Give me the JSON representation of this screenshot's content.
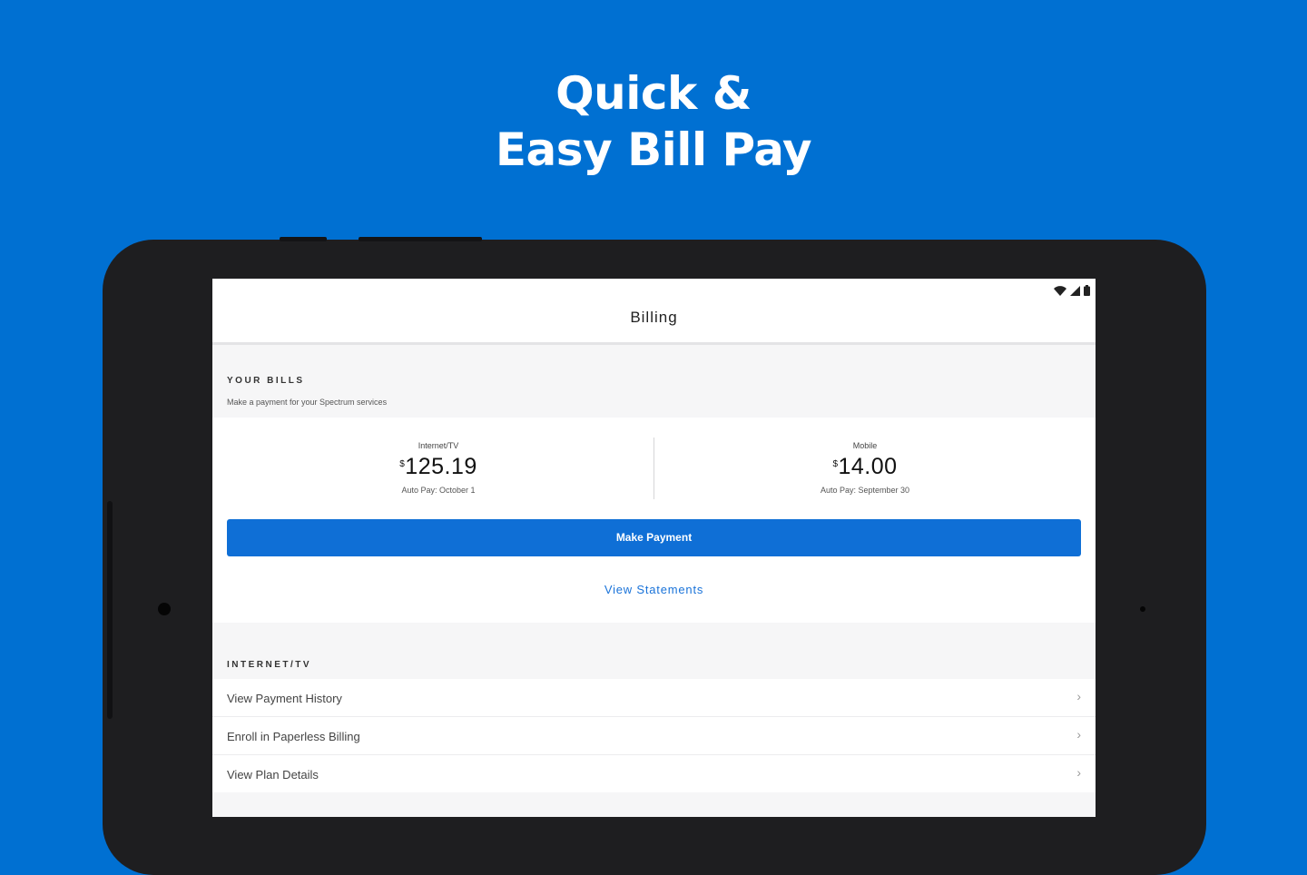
{
  "hero": {
    "line1": "Quick &",
    "line2": "Easy Bill Pay"
  },
  "appbar": {
    "title": "Billing"
  },
  "bills_section": {
    "label": "YOUR BILLS",
    "subtitle": "Make a payment for your Spectrum services",
    "bills": [
      {
        "label": "Internet/TV",
        "currency": "$",
        "amount": "125.19",
        "autopay": "Auto Pay: October 1"
      },
      {
        "label": "Mobile",
        "currency": "$",
        "amount": "14.00",
        "autopay": "Auto Pay: September 30"
      }
    ],
    "make_payment_label": "Make Payment",
    "view_statements_label": "View Statements"
  },
  "internet_section": {
    "label": "INTERNET/TV",
    "items": [
      {
        "label": "View Payment History"
      },
      {
        "label": "Enroll in Paperless Billing"
      },
      {
        "label": "View Plan Details"
      }
    ]
  },
  "icons": {
    "chevron": "chevron-right-icon",
    "wifi": "wifi-icon",
    "signal": "signal-icon",
    "battery": "battery-icon"
  },
  "colors": {
    "background": "#0070d2",
    "primary_button": "#0f6fd6",
    "link": "#1a73d9",
    "device": "#1e1e20"
  }
}
